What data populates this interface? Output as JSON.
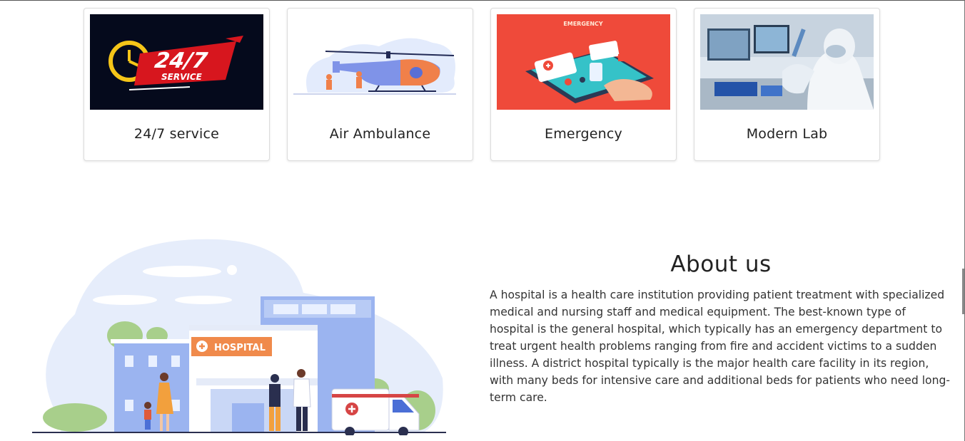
{
  "services": [
    {
      "title": "24/7 service",
      "image_icon": "24-7-service-icon",
      "badge_text": "24/7",
      "badge_sub": "SERVICE"
    },
    {
      "title": "Air Ambulance",
      "image_icon": "helicopter-icon"
    },
    {
      "title": "Emergency",
      "image_icon": "emergency-app-icon",
      "banner_text": "EMERGENCY"
    },
    {
      "title": "Modern Lab",
      "image_icon": "lab-icon"
    }
  ],
  "about": {
    "heading": "About us",
    "body": "A hospital is a health care institution providing patient treatment with specialized medical and nursing staff and medical equipment. The best-known type of hospital is the general hospital, which typically has an emergency department to treat urgent health problems ranging from fire and accident victims to a sudden illness. A district hospital typically is the major health care facility in its region, with many beds for intensive care and additional beds for patients who need long-term care.",
    "illustration_sign": "HOSPITAL"
  },
  "colors": {
    "accent_orange": "#f08a4b",
    "emergency_red": "#ef4a3a",
    "dark_navy": "#050a1c",
    "light_blue": "#dfe8fb"
  }
}
